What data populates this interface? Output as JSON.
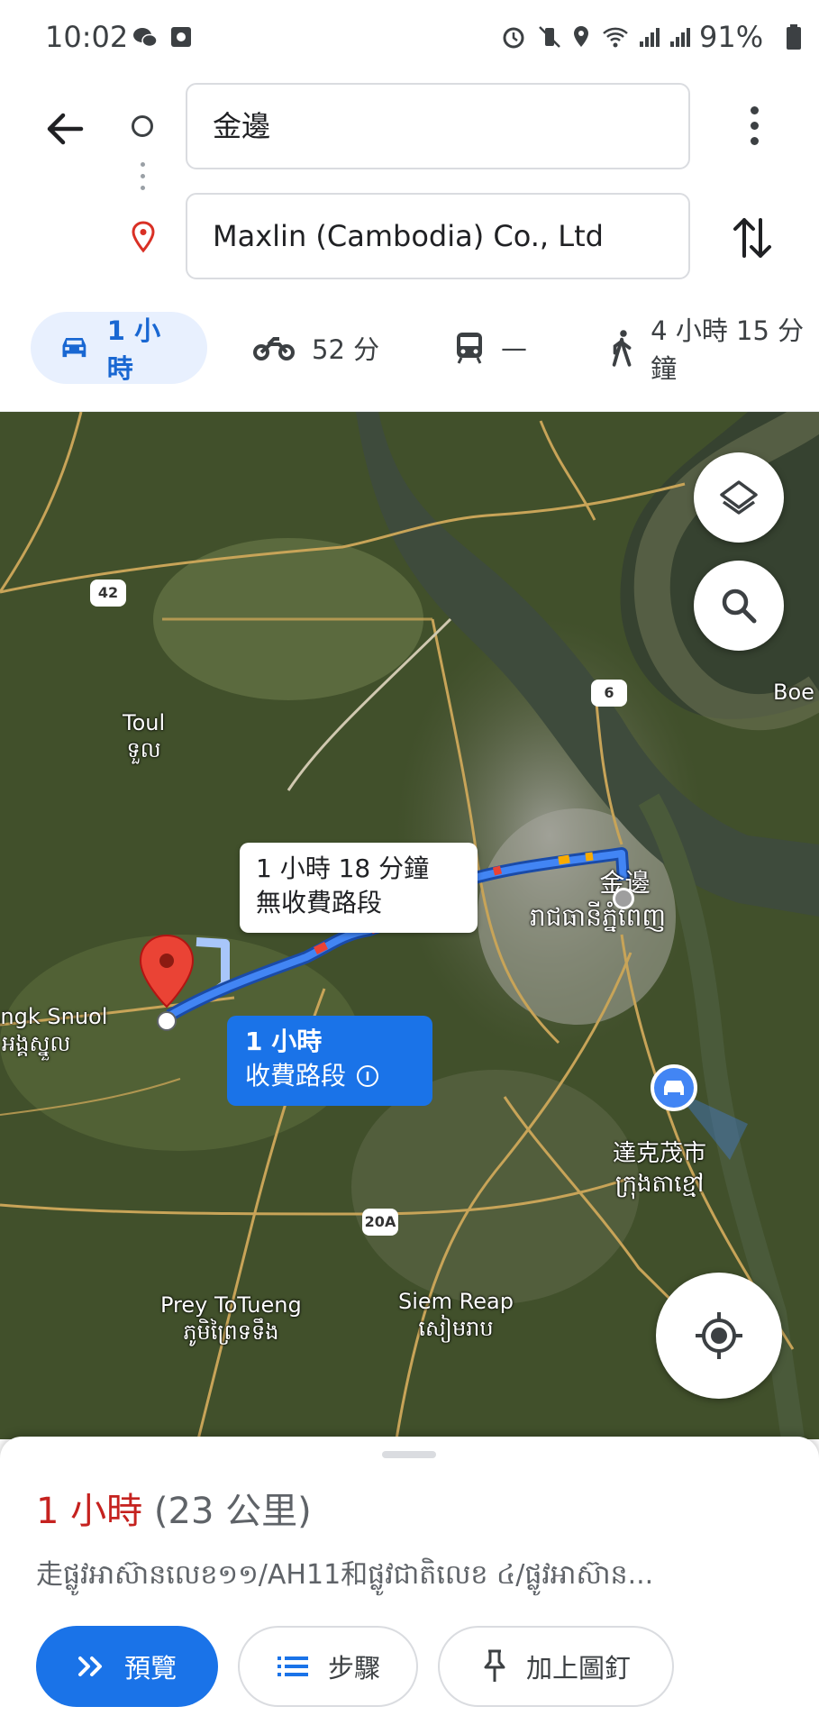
{
  "status_bar": {
    "time": "10:02",
    "battery": "91%"
  },
  "directions": {
    "origin": "金邊",
    "destination": "Maxlin (Cambodia) Co., Ltd"
  },
  "modes": [
    {
      "name": "drive",
      "label": "1 小時"
    },
    {
      "name": "motorcycle",
      "label": "52 分"
    },
    {
      "name": "transit",
      "label": "—"
    },
    {
      "name": "walk",
      "label": "4 小時 15 分鐘"
    }
  ],
  "map": {
    "labels": {
      "toul": "Toul",
      "toul_km": "ទួល",
      "angk_snuol": "Angk Snuol",
      "angk_snuol_km": "អង្គស្នួល",
      "phnom_penh_zh": "金邊",
      "phnom_penh_km": "រាជធានីភ្នំពេញ",
      "takhmao_zh": "達克茂市",
      "takhmao_km": "ក្រុងតាខ្មៅ",
      "prey_totueng": "Prey ToTueng",
      "prey_totueng_km": "ភូមិព្រៃទទឹង",
      "siem_reap": "Siem Reap",
      "siem_reap_km": "សៀមរាប",
      "boe": "Boe"
    },
    "shields": {
      "r42": "42",
      "r6": "6",
      "r20a": "20A"
    },
    "callout_alt": {
      "time": "1 小時 18 分鐘",
      "note": "無收費路段"
    },
    "callout_main": {
      "time": "1 小時",
      "note": "收費路段"
    }
  },
  "sheet": {
    "eta": "1 小時",
    "distance": "(23 公里)",
    "via": "走ផ្លូវអាស៊ានលេខ១១/AH11和ផ្លូវជាតិលេខ ៤/ផ្លូវអាស៊ាន...",
    "buttons": {
      "preview": "預覽",
      "steps": "步驟",
      "pin": "加上圖釘"
    }
  },
  "colors": {
    "accent": "#1a73e8",
    "eta_red": "#c5221f",
    "pin_red": "#ea4335"
  }
}
